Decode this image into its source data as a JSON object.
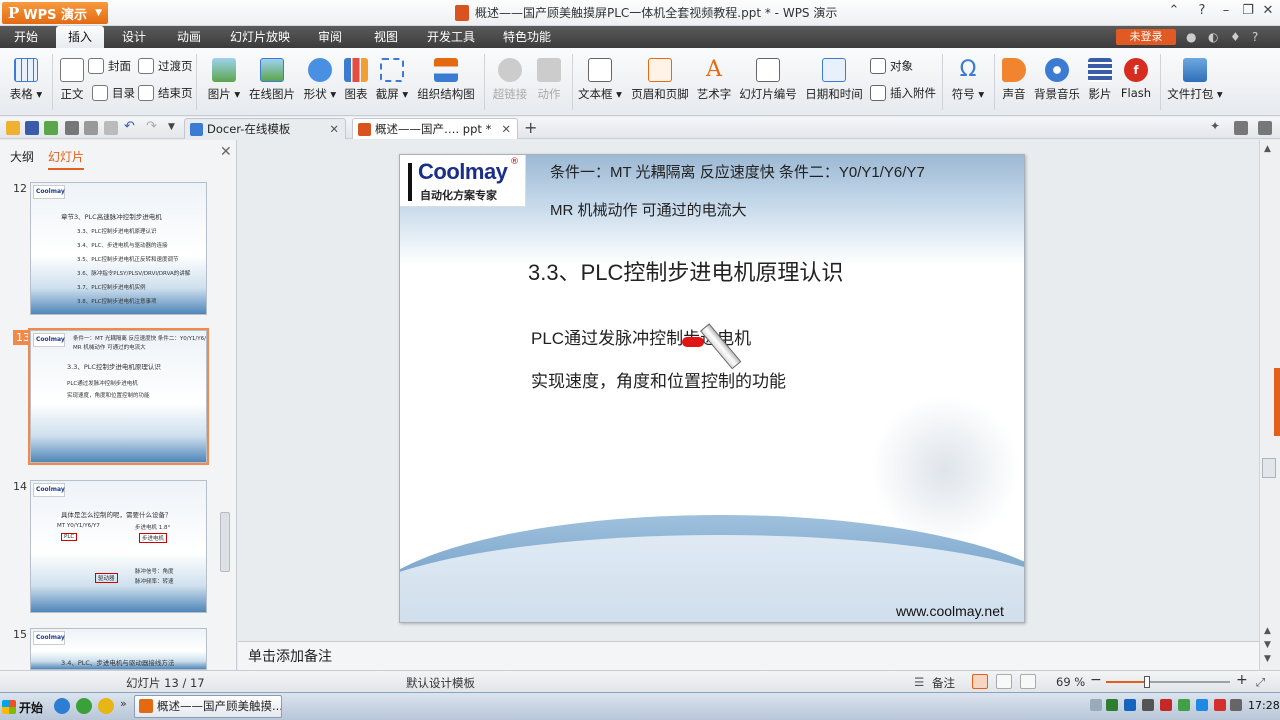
{
  "titlebar": {
    "app_label": "WPS 演示",
    "title": "概述——国产顾美触摸屏PLC一体机全套视频教程.ppt * - WPS 演示"
  },
  "menu": {
    "tabs": [
      "开始",
      "插入",
      "设计",
      "动画",
      "幻灯片放映",
      "审阅",
      "视图",
      "开发工具",
      "特色功能"
    ],
    "active": "插入",
    "login": "未登录"
  },
  "ribbon": {
    "table": "表格",
    "cover": "封面",
    "transition": "过渡页",
    "body": "正文",
    "toc": "目录",
    "ending": "结束页",
    "picture": "图片",
    "online_picture": "在线图片",
    "shape": "形状",
    "chart": "图表",
    "screenshot": "截屏",
    "org_chart": "组织结构图",
    "hyperlink": "超链接",
    "action": "动作",
    "textbox": "文本框",
    "header_footer": "页眉和页脚",
    "wordart": "艺术字",
    "slide_number": "幻灯片编号",
    "date_time": "日期和时间",
    "object": "对象",
    "attachment": "插入附件",
    "symbol": "符号",
    "sound": "声音",
    "bg_music": "背景音乐",
    "movie": "影片",
    "flash": "Flash",
    "package": "文件打包"
  },
  "doc_tabs": [
    {
      "label": "Docer-在线模板",
      "active": false
    },
    {
      "label": "概述——国产…. ppt *",
      "active": true
    }
  ],
  "panel": {
    "tabs": [
      "大纲",
      "幻灯片"
    ],
    "active": "幻灯片",
    "slides": [
      {
        "num": "12",
        "lines": [
          "章节3、PLC高速脉冲控制步进电机",
          "3.3、PLC控制步进电机原理认识",
          "3.4、PLC、步进电机与驱动器的连接",
          "3.5、PLC控制步进电机正反转和速度调节",
          "3.6、脉冲指令PLSY/PLSV/DRVI/DRVA的讲解",
          "3.7、PLC控制步进电机实例",
          "3.8、PLC控制步进电机注意事项"
        ]
      },
      {
        "num": "13",
        "lines": [
          "条件一：MT 光耦隔离 反应速度快 条件二：Y0/Y1/Y6/Y7",
          "MR 机械动作 可通过的电流大",
          "3.3、PLC控制步进电机原理认识",
          "PLC通过发脉冲控制步进电机",
          "实现速度，角度和位置控制的功能"
        ]
      },
      {
        "num": "14",
        "lines": [
          "具体是怎么控制的呢，需要什么设备？",
          "MT Y0/Y1/Y6/Y7",
          "步进电机 1.8°",
          "PLC",
          "步进电机",
          "驱动器",
          "脉冲信号：角度",
          "脉冲频率：转速"
        ]
      },
      {
        "num": "15",
        "lines": [
          "3.4、PLC、步进电机与驱动器接线方法"
        ]
      }
    ]
  },
  "slide": {
    "logo_brand": "Coolmay",
    "logo_reg": "®",
    "logo_sub": "自动化方案专家",
    "cond_line1": "条件一：MT  光耦隔离    反应速度快  条件二：Y0/Y1/Y6/Y7",
    "cond_line2": "MR  机械动作  可通过的电流大",
    "title": "3.3、PLC控制步进电机原理认识",
    "body1": "PLC通过发脉冲控制步进电机",
    "body2": "实现速度，角度和位置控制的功能",
    "url": "www.coolmay.net"
  },
  "notes": {
    "placeholder": "单击添加备注"
  },
  "status": {
    "slide_label": "幻灯片 13 / 17",
    "template": "默认设计模板",
    "notes": "备注",
    "zoom": "69 %",
    "zoom_fraction": 0.33
  },
  "taskbar": {
    "start": "开始",
    "task": "概述——国产顾美触摸...",
    "clock": "17:28"
  }
}
